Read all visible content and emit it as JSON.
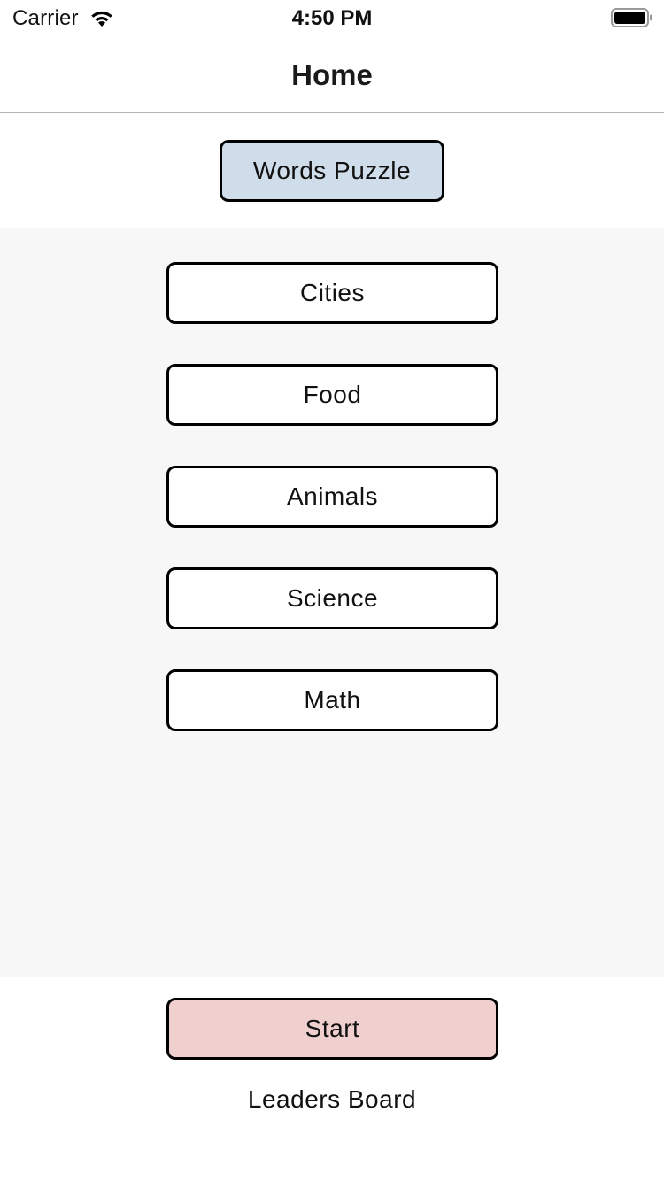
{
  "status_bar": {
    "carrier": "Carrier",
    "time": "4:50 PM",
    "icons": [
      "wifi-icon",
      "battery-icon"
    ]
  },
  "nav": {
    "title": "Home"
  },
  "header": {
    "words_puzzle_label": "Words Puzzle",
    "words_puzzle_color": "#cfdcea"
  },
  "categories": [
    {
      "label": "Cities"
    },
    {
      "label": "Food"
    },
    {
      "label": "Animals"
    },
    {
      "label": "Science"
    },
    {
      "label": "Math"
    }
  ],
  "footer": {
    "start_label": "Start",
    "start_color": "#efd0cf",
    "leaders_board_label": "Leaders Board"
  },
  "colors": {
    "category_background": "#f7f7f7",
    "border": "#000000"
  }
}
